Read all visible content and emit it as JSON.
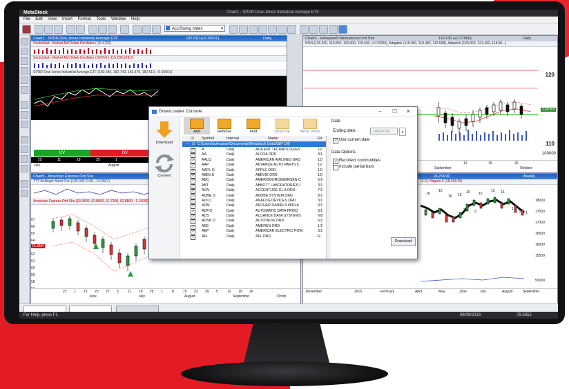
{
  "app": {
    "name": "MetaStock",
    "doc_title": "Chart1 - SPDR Dow Jones Industrial Average ETF"
  },
  "menu": [
    "File",
    "Edit",
    "View",
    "Insert",
    "Format",
    "Tools",
    "Window",
    "Help"
  ],
  "toolbar": {
    "indicator_select": "Acc/Swing Index"
  },
  "panes": {
    "chart1": {
      "title": "Chart1 - SPDR Dow Jones Industrial Average ETF",
      "price": "182.510 (+0.15001)",
      "period": "Daily",
      "sub1": "SectorStat - Market McClellan Oscillator (-20.4722)",
      "sub2": "SectorStat - Market McClellan Oscillator (UVDV) (-116,236,528.0)",
      "sub3": "SPDR Dow Jones Industrial Average ETF (182.340, 182.740, 181.470, 182.510, +0.15001)",
      "uv": "UV",
      "dv": "DV",
      "dates": [
        "25",
        "11",
        "18",
        "25",
        "1"
      ],
      "months": [
        "July",
        "August"
      ]
    },
    "chart3": {
      "title": "Chart3 - Honeywell International Ord Shs",
      "price": "115.630 (+0.37000)",
      "period": "Daily",
      "sub": "HON (115.320, 115.860, 115.000, 115.630, +0.37000), Adaptick (115.000, 118.492, 112.508), Adaptick (120.000, 121.492, 118.60...)",
      "axis": [
        "120",
        "110",
        "100000"
      ],
      "price_tag": "118.63",
      "dates": [
        "12",
        "19",
        "26"
      ],
      "months": [
        "September",
        "October"
      ]
    },
    "chart5": {
      "title": "Chart5 - American Express Ord Shs",
      "sub1": "TTT Bollinger Band Osc (100.000, 0.00, -13.9667)",
      "sub2": "American Express Ord Shs (63.3800, 63.8800, 61.7900, 62.8800, -1.16000)",
      "axis": [
        "67",
        "66",
        "65",
        "64",
        "63",
        "62",
        "61",
        "60",
        "59",
        "58",
        "57"
      ],
      "price_tag": "63.8800",
      "dates": [
        "23",
        "1",
        "13",
        "20",
        "27",
        "5",
        "11",
        "18",
        "25",
        "1",
        "8",
        "15",
        "22",
        "29",
        "5",
        "12",
        "19",
        "26"
      ],
      "months": [
        "June",
        "July",
        "August",
        "September",
        "Octob"
      ]
    },
    "chart_br": {
      "price": "18,258.00",
      "period": "Weekly",
      "sub": "(0.0), Heguru II (18,318.49)",
      "axis": [
        "18000",
        "17500",
        "17000",
        "16500",
        "16000",
        "15500",
        "50000"
      ],
      "months": [
        "November",
        "2016",
        "February",
        "April",
        "May",
        "June",
        "July",
        "August",
        "September"
      ],
      "labels": [
        "16",
        "15",
        "16",
        "13",
        "16",
        "16",
        "15",
        "16",
        "2",
        "2",
        "1",
        "3",
        "2",
        "1"
      ]
    }
  },
  "dialog": {
    "title": "DownLoader Console",
    "side": {
      "download": "Download",
      "convert": "Convert"
    },
    "tools": {
      "add": "Add",
      "remove": "Remove",
      "find": "Find",
      "move_up": "Move Up",
      "move_down": "Move Down"
    },
    "columns": {
      "symbol": "Symbol",
      "interval": "Interval",
      "name": "Name",
      "first": "Fir"
    },
    "path": "C:\\Users\\bclecassel\\Documents\\MetaStock Data\\S&P 100",
    "rows": [
      {
        "symbol": "A",
        "interval": "Daily",
        "name": "AGILENT TECHNOLOGIES",
        "first": "11/"
      },
      {
        "symbol": "AA",
        "interval": "Daily",
        "name": "ALCOA ORD",
        "first": "3/1"
      },
      {
        "symbol": "AALQ",
        "interval": "Daily",
        "name": "AMERICAN AIRLINES GRO",
        "first": "12/"
      },
      {
        "symbol": "AAP",
        "interval": "Daily",
        "name": "ADVANCE AUTO PARTS C",
        "first": "11/"
      },
      {
        "symbol": "AAPL.O",
        "interval": "Daily",
        "name": "APPLE ORD",
        "first": "12/"
      },
      {
        "symbol": "ABBV.K",
        "interval": "Daily",
        "name": "ABBVIE ORD",
        "first": "12/"
      },
      {
        "symbol": "ABC",
        "interval": "Daily",
        "name": "AMERISOURCEBERGEN C",
        "first": "5/2"
      },
      {
        "symbol": "ABT",
        "interval": "Daily",
        "name": "ABBOTT LABORATORIES I",
        "first": "3/1"
      },
      {
        "symbol": "ACN",
        "interval": "Daily",
        "name": "ACCENTURE CL A ORD",
        "first": "7/1"
      },
      {
        "symbol": "ADBE.O",
        "interval": "Daily",
        "name": "ADOBE SYSTEM ORD",
        "first": "8/1"
      },
      {
        "symbol": "ADI.O",
        "interval": "Daily",
        "name": "ANALOG DEVICES ORD",
        "first": "3/1"
      },
      {
        "symbol": "ADM",
        "interval": "Daily",
        "name": "ARCHER DANIELS MIDLA",
        "first": "3/1"
      },
      {
        "symbol": "ADP.O",
        "interval": "Daily",
        "name": "AUTOMATIC DATA PROCI",
        "first": "3/1"
      },
      {
        "symbol": "ADS",
        "interval": "Daily",
        "name": "ALLIANCE DATA SYSTEMS",
        "first": "6/8"
      },
      {
        "symbol": "ADSK.O",
        "interval": "Daily",
        "name": "AUTODESK ORD",
        "first": "6/2"
      },
      {
        "symbol": "AEE",
        "interval": "Daily",
        "name": "AMEREN ORD",
        "first": "1/2"
      },
      {
        "symbol": "AEP",
        "interval": "Daily",
        "name": "AMERICAN ELECTRIC POW",
        "first": "3/1"
      },
      {
        "symbol": "AFL",
        "interval": "Daily",
        "name": "AFL ORD",
        "first": "6/"
      }
    ],
    "date_section": "Date",
    "ending_date_label": "Ending date:",
    "ending_date_value": "10/6/2016",
    "use_current_date": "Use current date",
    "data_options": "Data Options",
    "recollect": "Recollect commodities",
    "include_partial": "Include partial bars",
    "download_button": "Download"
  },
  "status": {
    "help": "For Help, press F1",
    "date": "08/09/2016",
    "value": "79.5852"
  },
  "colors": {
    "accent_red": "#e21b24",
    "title_blue": "#1f5fb8",
    "download_orange": "#f0a829"
  }
}
